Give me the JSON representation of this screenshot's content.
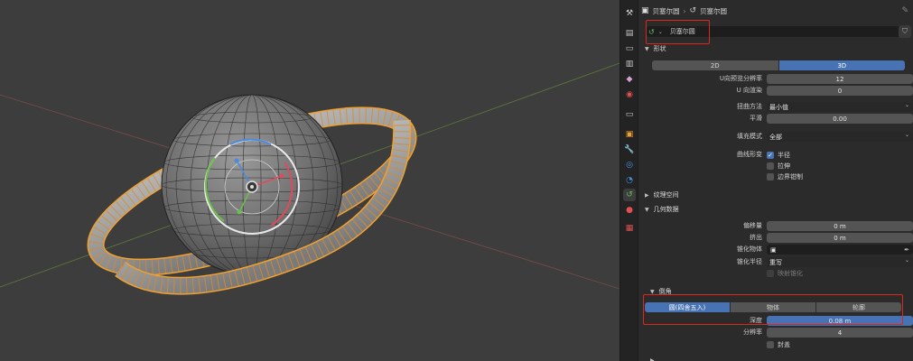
{
  "header": {
    "object_name": "贝塞尔圆",
    "data_name": "贝塞尔圆"
  },
  "name_field": {
    "value": "贝塞尔圆"
  },
  "shape": {
    "title": "形状",
    "dim_2d": "2D",
    "dim_3d": "3D",
    "u_preview_label": "U向预览分辨率",
    "u_preview_value": "12",
    "u_render_label": "U 向渲染",
    "u_render_value": "0",
    "twist_method_label": "扭曲方法",
    "twist_method_value": "最小值",
    "smooth_label": "平滑",
    "smooth_value": "0.00",
    "fill_mode_label": "填充模式",
    "fill_mode_value": "全部",
    "curve_deform_label": "曲线形变",
    "radius_label": "半径",
    "stretch_label": "拉伸",
    "bounds_clamp_label": "边界钳制"
  },
  "texture_space": {
    "title": "纹理空间"
  },
  "geometry": {
    "title": "几何数据",
    "offset_label": "偏移量",
    "offset_value": "0 m",
    "extrude_label": "挤出",
    "extrude_value": "0 m",
    "taper_object_label": "锥化物体",
    "taper_radius_label": "锥化半径",
    "taper_radius_value": "重写",
    "map_taper_label": "映射锥化"
  },
  "bevel": {
    "title": "倒角",
    "mode_round": "圆(四舍五入)",
    "mode_object": "物体",
    "mode_profile": "轮廓",
    "depth_label": "深度",
    "depth_value": "0.08 m",
    "resolution_label": "分辨率",
    "resolution_value": "4",
    "fill_caps_label": "封盖"
  },
  "colors": {
    "accent": "#4772b3",
    "highlight": "#e0261c",
    "selection": "#f0a030"
  }
}
